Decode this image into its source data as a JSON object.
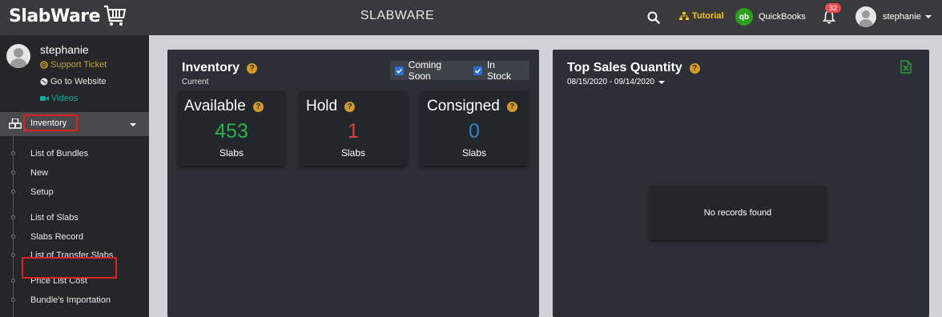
{
  "brand": {
    "name": "SlabWare"
  },
  "topbar": {
    "title": "SLABWARE",
    "tutorial_label": "Tutorial",
    "quickbooks_icon": "qb",
    "quickbooks_label": "QuickBooks",
    "notification_count": "32",
    "user_name": "stephanie"
  },
  "sidebar": {
    "profile": {
      "name": "stephanie",
      "support_label": "Support Ticket",
      "website_label": "Go to Website",
      "videos_label": "Videos"
    },
    "active_menu": "Inventory",
    "submenu": [
      "List of Bundles",
      "New",
      "Setup",
      "List of Slabs",
      "Slabs Record",
      "List of Transfer Slabs",
      "Price List Cost",
      "Bundle's Importation"
    ]
  },
  "inventory_panel": {
    "title": "Inventory",
    "subtitle": "Current",
    "filters": [
      {
        "label": "Coming Soon",
        "checked": true
      },
      {
        "label": "In Stock",
        "checked": true
      }
    ],
    "stats": [
      {
        "title": "Available",
        "value": "453",
        "unit": "Slabs",
        "color": "#2bb24c"
      },
      {
        "title": "Hold",
        "value": "1",
        "unit": "Slabs",
        "color": "#d9423a"
      },
      {
        "title": "Consigned",
        "value": "0",
        "unit": "Slabs",
        "color": "#2f86c9"
      }
    ]
  },
  "sales_panel": {
    "title": "Top Sales Quantity",
    "date_range": "08/15/2020 - 09/14/2020",
    "empty_message": "No records found"
  },
  "colors": {
    "accent_gold": "#d59a2a",
    "checkbox_blue": "#2b6fd6",
    "highlight_red": "#e02020",
    "excel_green": "#2a9d3a"
  }
}
